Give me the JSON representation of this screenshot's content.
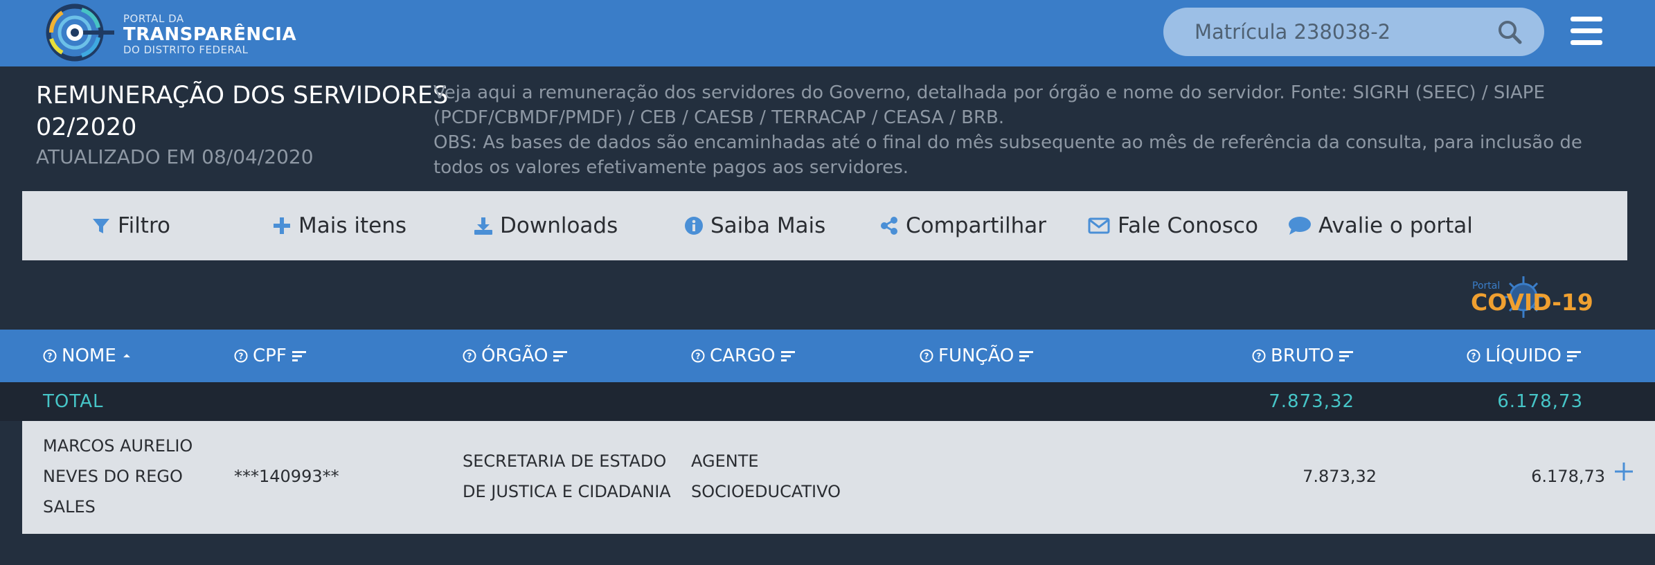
{
  "header": {
    "logo": {
      "line1": "PORTAL DA",
      "line2": "TRANSPARÊNCIA",
      "line3": "DO DISTRITO FEDERAL"
    },
    "search_placeholder": "Matrícula 238038-2"
  },
  "page": {
    "title_line1": "REMUNERAÇÃO DOS SERVIDORES",
    "title_line2": "02/2020",
    "updated": "ATUALIZADO EM 08/04/2020",
    "description": "Veja aqui a remuneração dos servidores do Governo, detalhada por órgão e nome do servidor. Fonte: SIGRH (SEEC) / SIAPE (PCDF/CBMDF/PMDF) / CEB / CAESB / TERRACAP / CEASA / BRB.",
    "obs": "OBS: As bases de dados são encaminhadas até o final do mês subsequente ao mês de referência da consulta, para inclusão de todos os valores efetivamente pagos aos servidores."
  },
  "toolbar": {
    "filtro": "Filtro",
    "mais_itens": "Mais itens",
    "downloads": "Downloads",
    "saiba_mais": "Saiba Mais",
    "compartilhar": "Compartilhar",
    "fale_conosco": "Fale Conosco",
    "avalie": "Avalie o portal"
  },
  "covid_badge": {
    "portal": "Portal",
    "covid": "COVID",
    "number": "-19"
  },
  "table": {
    "headers": {
      "nome": "NOME",
      "cpf": "CPF",
      "orgao": "ÓRGÃO",
      "cargo": "CARGO",
      "funcao": "FUNÇÃO",
      "bruto": "BRUTO",
      "liquido": "LÍQUIDO"
    },
    "total": {
      "label": "TOTAL",
      "bruto": "7.873,32",
      "liquido": "6.178,73"
    },
    "rows": [
      {
        "nome_lines": [
          "MARCOS AURELIO",
          "NEVES DO REGO",
          "SALES"
        ],
        "cpf": "***140993**",
        "orgao_lines": [
          "SECRETARIA DE ESTADO",
          "DE JUSTICA E CIDADANIA"
        ],
        "cargo_lines": [
          "AGENTE",
          "SOCIOEDUCATIVO"
        ],
        "funcao": "",
        "bruto": "7.873,32",
        "liquido": "6.178,73"
      }
    ]
  },
  "colors": {
    "header_blue": "#3a7dc8",
    "dark_bg": "#232f3e",
    "panel_gray": "#dde1e6",
    "total_teal": "#46c5c7",
    "icon_blue": "#4a8fd6"
  }
}
